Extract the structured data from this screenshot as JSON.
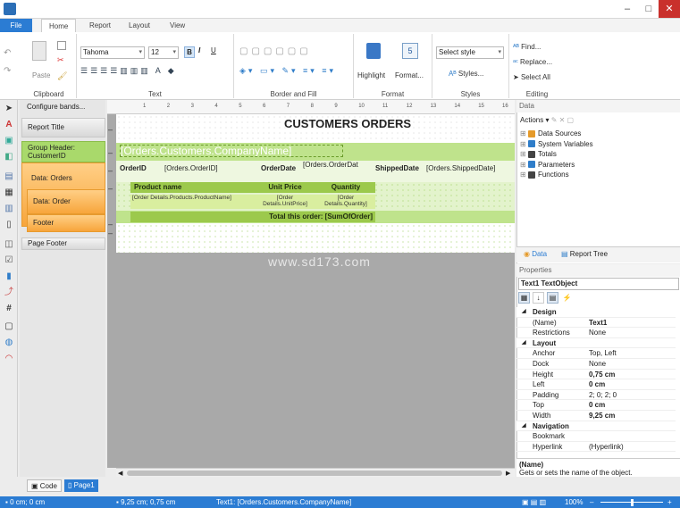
{
  "window": {
    "minimize": "–",
    "maximize": "□",
    "close": "✕"
  },
  "tabs": [
    "File",
    "Home",
    "Report",
    "Layout",
    "View"
  ],
  "ribbon": {
    "paste_label": "Paste",
    "font_name": "Tahoma",
    "font_size": "12",
    "bold": "B",
    "italic": "I",
    "underline": "U",
    "highlight_label": "Highlight",
    "format_label": "Format...",
    "select_style": "Select style",
    "styles_label": "Styles...",
    "find_label": "Find...",
    "replace_label": "Replace...",
    "select_all_label": "Select All",
    "groups": [
      "Clipboard",
      "Text",
      "Border and Fill",
      "Format",
      "Styles",
      "Editing"
    ]
  },
  "bands": {
    "configure": "Configure bands...",
    "report_title": "Report Title",
    "group_header": "Group Header: CustomerID",
    "data_orders": "Data: Orders",
    "data_order": "Data: Order",
    "footer": "Footer",
    "page_footer": "Page Footer"
  },
  "ruler_ticks": [
    "1",
    "2",
    "3",
    "4",
    "5",
    "6",
    "7",
    "8",
    "9",
    "10",
    "11",
    "12",
    "13",
    "14",
    "15",
    "16"
  ],
  "report": {
    "title": "CUSTOMERS ORDERS",
    "company": "[Orders.Customers.CompanyName]",
    "orderid_label": "OrderID",
    "orderid_value": "[Orders.OrderID]",
    "orderdate_label": "OrderDate",
    "orderdate_value": "[Orders.OrderDat",
    "shippeddate_label": "ShippedDate",
    "shippeddate_value": "[Orders.ShippedDate]",
    "col_product": "Product name",
    "col_price": "Unit Price",
    "col_qty": "Quantity",
    "val_product": "[Order Details.Products.ProductName]",
    "val_price": "[Order Details.UnitPrice]",
    "val_qty": "[Order Details.Quantity]",
    "total": "Total this order: [SumOfOrder]"
  },
  "watermark": "www.sd173.com",
  "data_panel": {
    "title": "Data",
    "actions": "Actions",
    "items": [
      "Data Sources",
      "System Variables",
      "Totals",
      "Parameters",
      "Functions"
    ],
    "tab_data": "Data",
    "tab_report_tree": "Report Tree"
  },
  "properties": {
    "title": "Properties",
    "selected": "Text1  TextObject",
    "rows": [
      {
        "name": "Design",
        "value": "",
        "cat": true
      },
      {
        "name": "(Name)",
        "value": "Text1"
      },
      {
        "name": "Restrictions",
        "value": "None"
      },
      {
        "name": "Layout",
        "value": "",
        "cat": true
      },
      {
        "name": "Anchor",
        "value": "Top, Left"
      },
      {
        "name": "Dock",
        "value": "None"
      },
      {
        "name": "Height",
        "value": "0,75 cm"
      },
      {
        "name": "Left",
        "value": "0 cm"
      },
      {
        "name": "Padding",
        "value": "2; 0; 2; 0"
      },
      {
        "name": "Top",
        "value": "0 cm"
      },
      {
        "name": "Width",
        "value": "9,25 cm"
      },
      {
        "name": "Navigation",
        "value": "",
        "cat": true
      },
      {
        "name": "Bookmark",
        "value": ""
      },
      {
        "name": "Hyperlink",
        "value": "(Hyperlink)"
      }
    ],
    "desc_title": "(Name)",
    "desc_text": "Gets or sets the name of the object."
  },
  "bottom_tabs": [
    "Code",
    "Page1"
  ],
  "status": {
    "pos": "0 cm; 0 cm",
    "size": "9,25 cm; 0,75 cm",
    "text": "Text1:  [Orders.Customers.CompanyName]",
    "zoom": "100%"
  }
}
